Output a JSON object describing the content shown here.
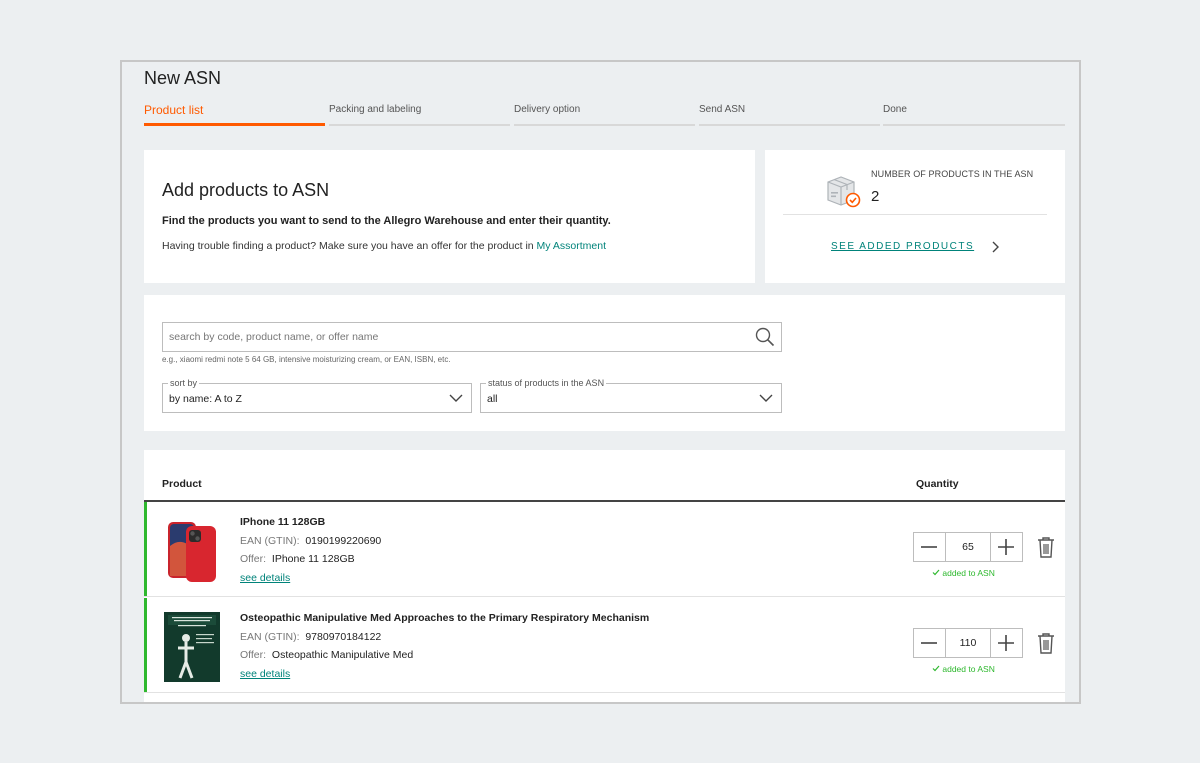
{
  "page": {
    "title": "New ASN"
  },
  "stepper": {
    "steps": [
      {
        "label": "Product list",
        "active": true
      },
      {
        "label": "Packing and labeling",
        "active": false
      },
      {
        "label": "Delivery option",
        "active": false
      },
      {
        "label": "Send ASN",
        "active": false
      },
      {
        "label": "Done",
        "active": false
      }
    ]
  },
  "add_card": {
    "title": "Add products to ASN",
    "description": "Find the products you want to send to the Allegro Warehouse and enter their quantity.",
    "help_text": "Having trouble finding a product? Make sure you have an offer for the product in",
    "help_link": "My Assortment"
  },
  "count_card": {
    "label": "NUMBER OF PRODUCTS IN THE ASN",
    "value": "2",
    "link": "SEE ADDED PRODUCTS"
  },
  "search": {
    "placeholder": "search by code, product name, or offer name",
    "value": "",
    "hint": "e.g., xiaomi redmi note 5 64 GB, intensive moisturizing cream, or EAN, ISBN, etc.",
    "sort_label": "sort by",
    "sort_value": "by name: A to Z",
    "status_label": "status of products in the ASN",
    "status_value": "all"
  },
  "table": {
    "col_product": "Product",
    "col_quantity": "Quantity",
    "rows": [
      {
        "name": "IPhone 11 128GB",
        "ean_label": "EAN (GTIN):",
        "ean": "0190199220690",
        "offer_label": "Offer:",
        "offer": "IPhone 11 128GB",
        "details": "see details",
        "quantity": "65",
        "status": "added to ASN"
      },
      {
        "name": "Osteopathic Manipulative Med Approaches to the Primary Respiratory Mechanism",
        "ean_label": "EAN (GTIN):",
        "ean": "9780970184122",
        "offer_label": "Offer:",
        "offer": "Osteopathic Manipulative Med",
        "details": "see details",
        "quantity": "110",
        "status": "added to ASN"
      }
    ]
  },
  "colors": {
    "accent": "#ff5a00",
    "link": "#00837a",
    "success": "#2eb82e"
  },
  "icons": [
    "search-icon",
    "chevron-down-icon",
    "chevron-right-icon",
    "box-check-icon",
    "minus-icon",
    "plus-icon",
    "trash-icon",
    "check-icon"
  ]
}
